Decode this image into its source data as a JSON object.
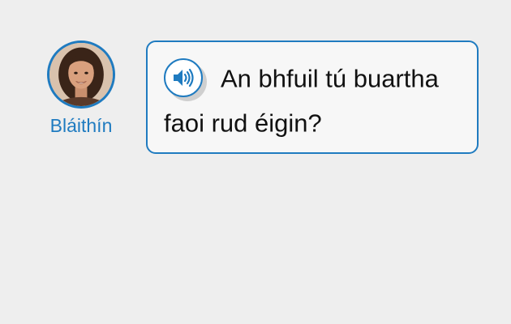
{
  "speaker": {
    "name": "Bláithín",
    "avatar_icon": "woman-portrait"
  },
  "message": {
    "text": "An bhfuil tú buartha faoi rud éigin?",
    "audio_icon": "speaker-volume-icon"
  },
  "colors": {
    "accent": "#1f7bc0",
    "background": "#eeeeee",
    "bubble_bg": "#f7f7f7"
  }
}
